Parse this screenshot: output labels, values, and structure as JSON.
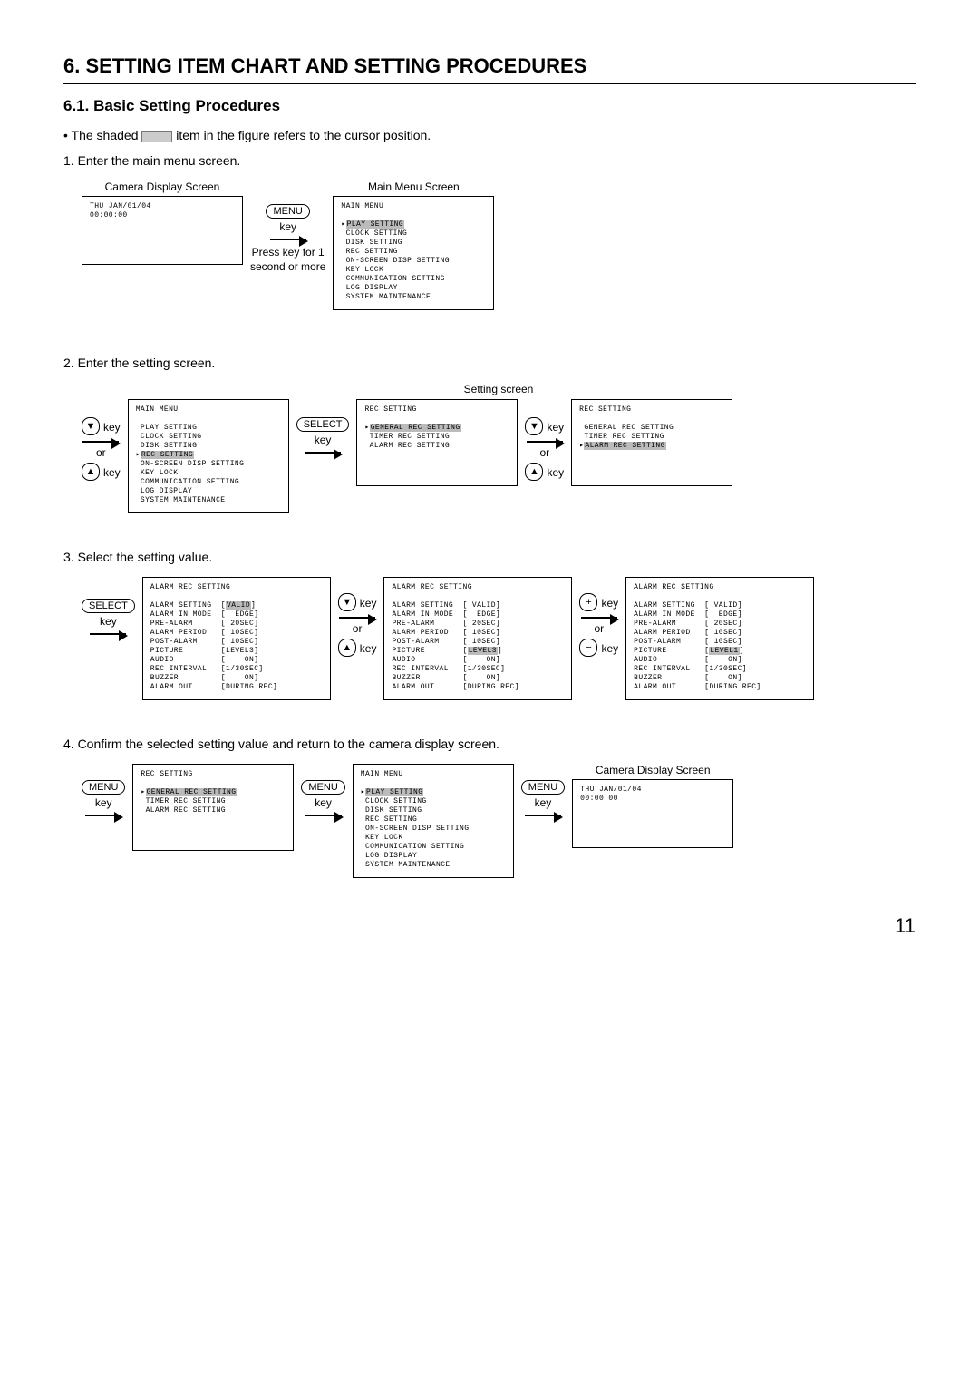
{
  "heading": "6. SETTING ITEM CHART AND SETTING PROCEDURES",
  "subheading": "6.1. Basic Setting Procedures",
  "intro_before": "• The shaded ",
  "intro_after": " item in the figure refers to the cursor position.",
  "step1": "1. Enter the main menu screen.",
  "step2": "2. Enter the setting screen.",
  "step3": "3. Select the setting value.",
  "step4": "4. Confirm the selected setting value and return to the camera display screen.",
  "labels": {
    "camera_screen": "Camera Display Screen",
    "main_menu_screen": "Main Menu Screen",
    "setting_screen": "Setting screen",
    "menu_btn": "MENU",
    "select_btn": "SELECT",
    "key": "key",
    "or": "or",
    "press_note": "Press key for 1\nsecond or more"
  },
  "camera": {
    "line1": "THU JAN/01/04",
    "line2": "00:00:00"
  },
  "main_menu": {
    "title": "MAIN MENU",
    "items": [
      "PLAY SETTING",
      "CLOCK SETTING",
      "DISK SETTING",
      "REC SETTING",
      "ON-SCREEN DISP SETTING",
      "KEY LOCK",
      "COMMUNICATION SETTING",
      "LOG DISPLAY",
      "SYSTEM MAINTENANCE"
    ],
    "cursor1": 0,
    "cursor2": 3
  },
  "rec_setting": {
    "title": "REC SETTING",
    "items": [
      "GENERAL REC SETTING",
      "TIMER REC SETTING",
      "ALARM REC SETTING"
    ],
    "cursor_a": 0,
    "cursor_b": 2
  },
  "alarm": {
    "title": "ALARM REC SETTING",
    "rows": [
      {
        "k": "ALARM SETTING",
        "v": "VALID"
      },
      {
        "k": "ALARM IN MODE",
        "v": "EDGE"
      },
      {
        "k": "PRE-ALARM",
        "v": "20SEC"
      },
      {
        "k": "ALARM PERIOD",
        "v": "10SEC"
      },
      {
        "k": "POST-ALARM",
        "v": "10SEC"
      },
      {
        "k": "PICTURE",
        "v": "LEVEL3"
      },
      {
        "k": "AUDIO",
        "v": "ON"
      },
      {
        "k": "REC INTERVAL",
        "v": "1/30SEC"
      },
      {
        "k": "BUZZER",
        "v": "ON"
      },
      {
        "k": "ALARM OUT",
        "v": "DURING REC"
      }
    ],
    "picture_alt": "LEVEL1"
  },
  "page_number": "11"
}
